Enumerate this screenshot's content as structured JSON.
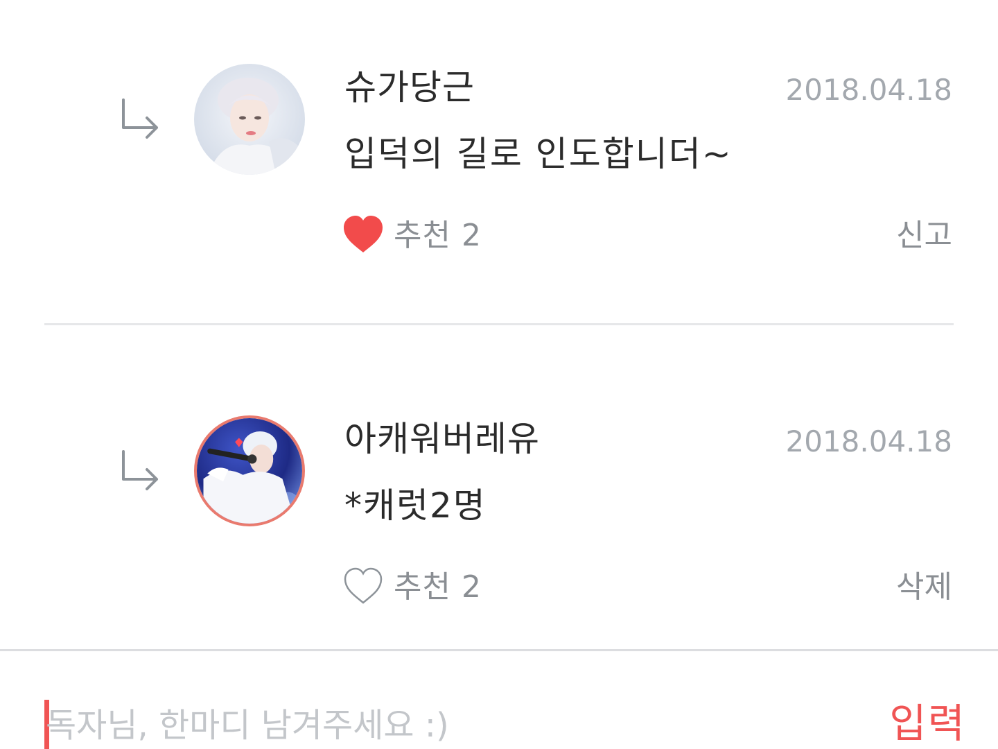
{
  "comments": [
    {
      "author": "슈가당근",
      "date": "2018.04.18",
      "text": "입덕의 길로 인도합니더~",
      "like_label": "추천 2",
      "liked": true,
      "action_label": "신고",
      "reply_icon": "reply-arrow-icon",
      "like_icon": "heart-filled-icon"
    },
    {
      "author": "아캐워버레유",
      "date": "2018.04.18",
      "text": "*캐럿2명",
      "like_label": "추천 2",
      "liked": false,
      "action_label": "삭제",
      "reply_icon": "reply-arrow-icon",
      "like_icon": "heart-outline-icon"
    }
  ],
  "composer": {
    "placeholder": "독자님, 한마디 남겨주세요 :)",
    "value": "",
    "submit_label": "입력"
  },
  "colors": {
    "accent": "#f05454",
    "heart": "#f24b4b",
    "meta_text": "#8a8e93",
    "date_text": "#a3a8ae",
    "body_text": "#2b2b2b",
    "divider": "#e6e7e9"
  }
}
